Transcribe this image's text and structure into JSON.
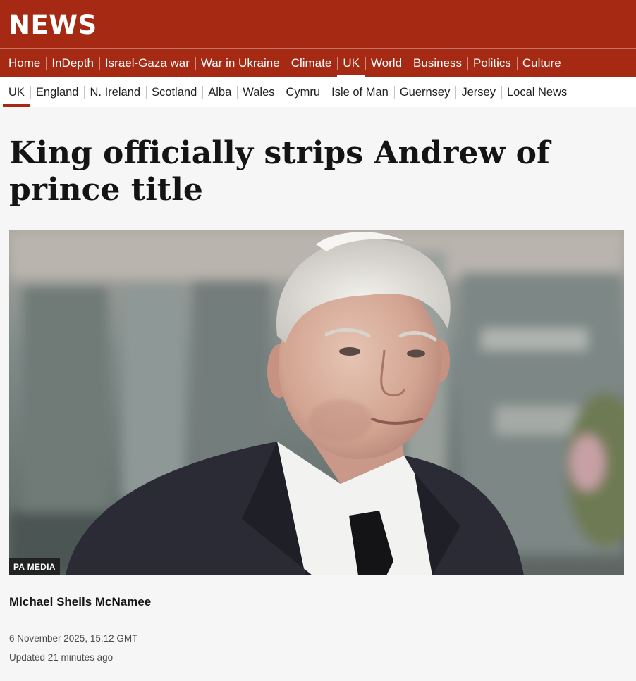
{
  "brand": {
    "title": "NEWS"
  },
  "primary_nav": [
    {
      "label": "Home"
    },
    {
      "label": "InDepth"
    },
    {
      "label": "Israel-Gaza war"
    },
    {
      "label": "War in Ukraine"
    },
    {
      "label": "Climate"
    },
    {
      "label": "UK",
      "active": true
    },
    {
      "label": "World"
    },
    {
      "label": "Business"
    },
    {
      "label": "Politics"
    },
    {
      "label": "Culture"
    }
  ],
  "secondary_nav": [
    {
      "label": "UK",
      "active": true
    },
    {
      "label": "England"
    },
    {
      "label": "N. Ireland"
    },
    {
      "label": "Scotland"
    },
    {
      "label": "Alba"
    },
    {
      "label": "Wales"
    },
    {
      "label": "Cymru"
    },
    {
      "label": "Isle of Man"
    },
    {
      "label": "Guernsey"
    },
    {
      "label": "Jersey"
    },
    {
      "label": "Local News"
    }
  ],
  "article": {
    "headline": "King officially strips Andrew of prince title",
    "image_credit": "PA MEDIA",
    "author": "Michael Sheils McNamee",
    "published": "6 November 2025, 15:12 GMT",
    "updated": "Updated 21 minutes ago"
  },
  "colors": {
    "brand_red": "#a62a13",
    "page_bg": "#f6f6f6",
    "text": "#141414"
  }
}
